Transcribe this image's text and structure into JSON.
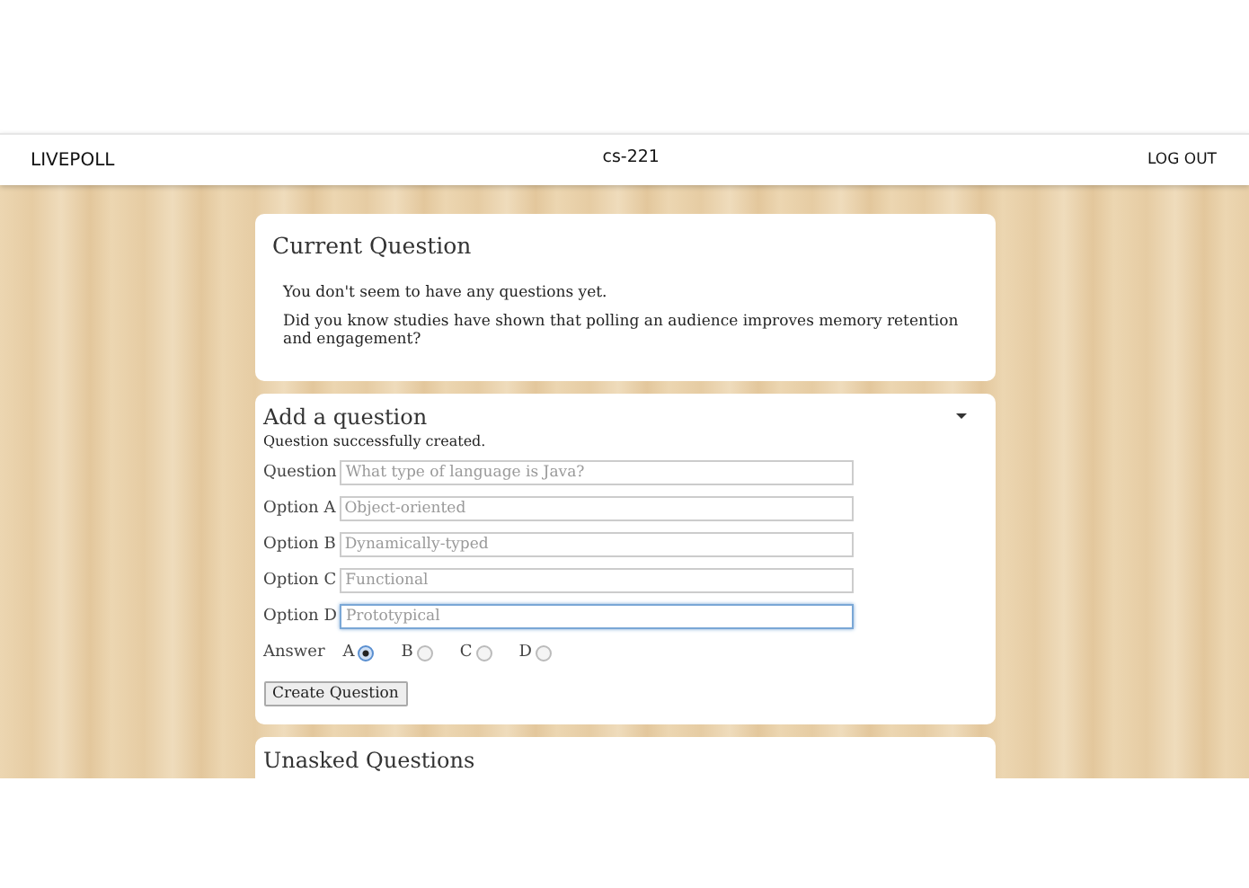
{
  "header": {
    "brand": "LIVEPOLL",
    "course": "cs-221",
    "logout": "LOG OUT"
  },
  "current_question": {
    "title": "Current Question",
    "messages": [
      "You don't seem to have any questions yet.",
      "Did you know studies have shown that polling an audience improves memory retention and engagement?"
    ]
  },
  "add_question": {
    "title": "Add a question",
    "expanded": true,
    "status": "Question successfully created.",
    "fields": [
      {
        "label": "Question",
        "placeholder": "What type of language is Java?",
        "focused": false
      },
      {
        "label": "Option A",
        "placeholder": "Object-oriented",
        "focused": false
      },
      {
        "label": "Option B",
        "placeholder": "Dynamically-typed",
        "focused": false
      },
      {
        "label": "Option C",
        "placeholder": "Functional",
        "focused": false
      },
      {
        "label": "Option D",
        "placeholder": "Prototypical",
        "focused": true
      }
    ],
    "answer_label": "Answer",
    "answers": [
      {
        "label": "A",
        "selected": true
      },
      {
        "label": "B",
        "selected": false
      },
      {
        "label": "C",
        "selected": false
      },
      {
        "label": "D",
        "selected": false
      }
    ],
    "submit": "Create Question"
  },
  "unasked_questions": {
    "title": "Unasked Questions"
  }
}
